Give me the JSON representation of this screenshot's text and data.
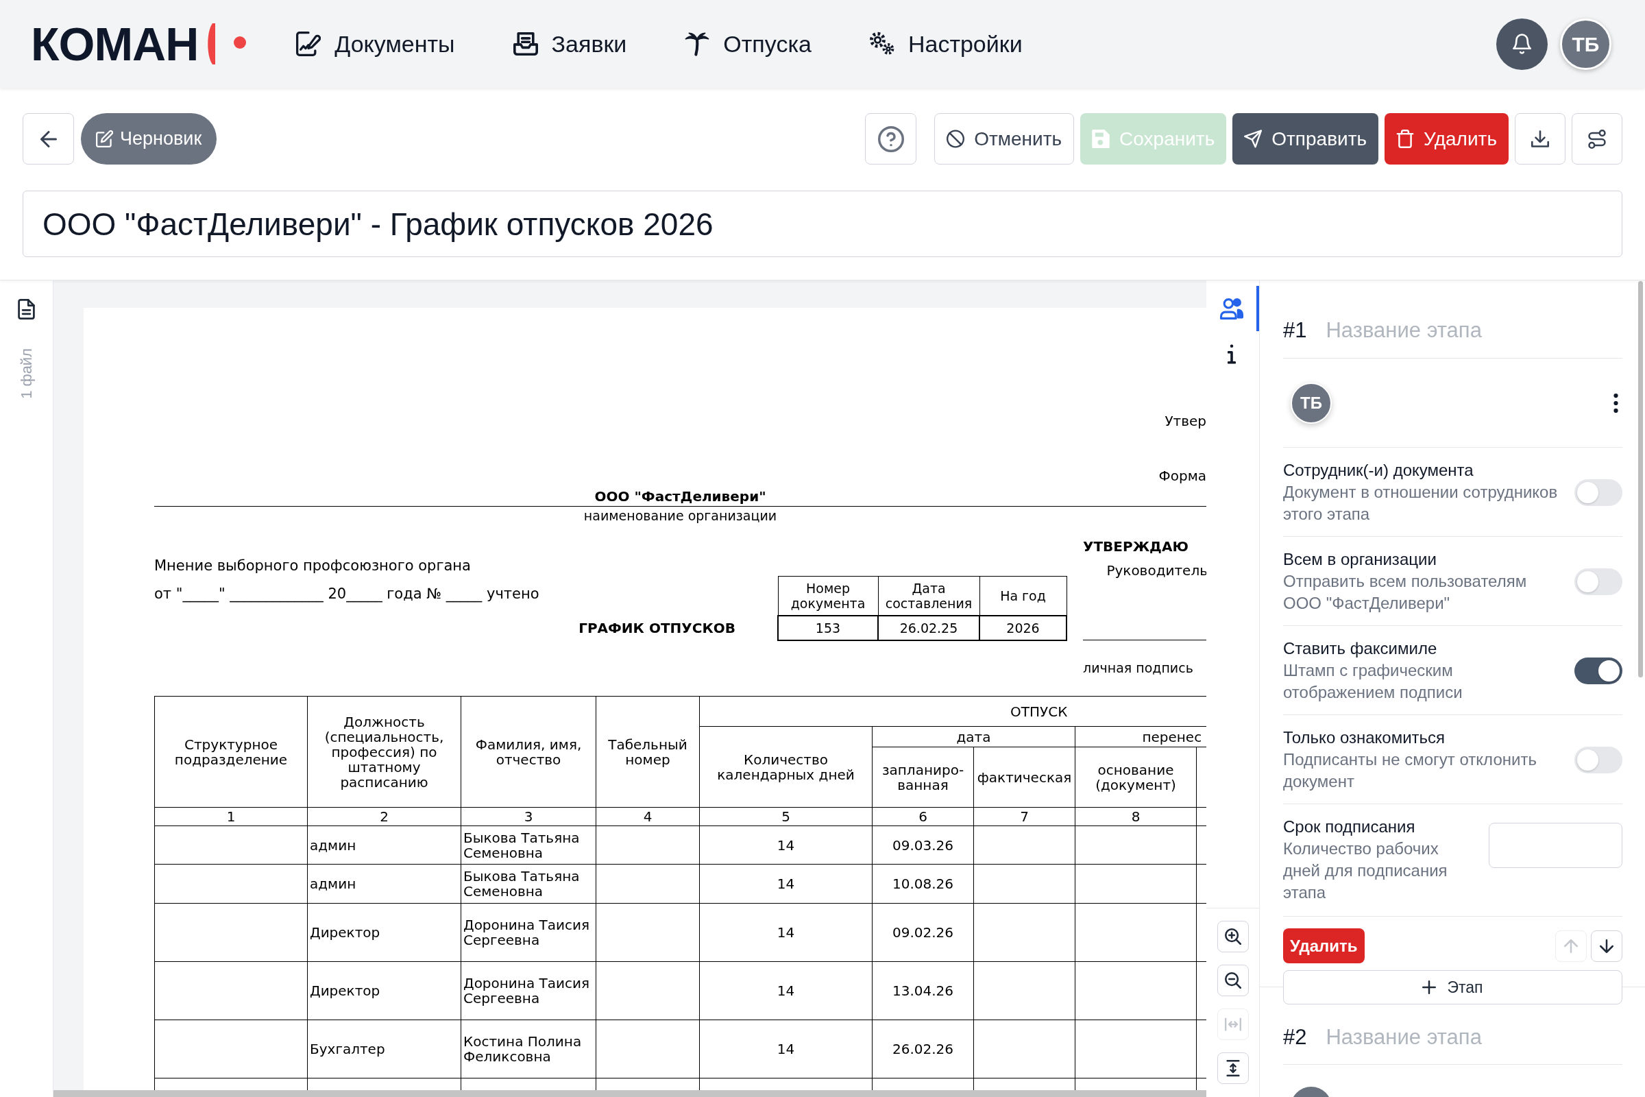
{
  "header": {
    "logo": "КОМАН",
    "nav": [
      {
        "label": "Документы"
      },
      {
        "label": "Заявки"
      },
      {
        "label": "Отпуска"
      },
      {
        "label": "Настройки"
      }
    ],
    "user_initials": "ТБ"
  },
  "toolbar": {
    "status": "Черновик",
    "actions": [
      {
        "label": "Отменить",
        "kind": "cancel",
        "disabled": false
      },
      {
        "label": "Сохранить",
        "kind": "save",
        "disabled": true
      },
      {
        "label": "Отправить",
        "kind": "send",
        "disabled": false
      },
      {
        "label": "Удалить",
        "kind": "delete",
        "disabled": false
      }
    ],
    "title": "ООО \"ФастДеливери\" - График отпусков 2026"
  },
  "files": {
    "count_label": "1 файл"
  },
  "document": {
    "corner_lines": [
      "Утвер",
      "Форма"
    ],
    "organization": "ООО \"ФастДеливери\"",
    "organization_caption": "наименование организации",
    "union_opinion": "Мнение выборного профсоюзного органа",
    "union_record": "от \"_____\" _____________ 20_____ года № _____ учтено",
    "heading": "ГРАФИК ОТПУСКОВ",
    "meta": {
      "columns": [
        "Номер документа",
        "Дата составления",
        "На год"
      ],
      "values": [
        "153",
        "26.02.25",
        "2026"
      ]
    },
    "approval": {
      "heading": "УТВЕРЖДАЮ",
      "role": "Руководитель",
      "signature_caption": "личная подпись"
    },
    "schedule": {
      "group_header": "ОТПУСК",
      "date_header": "дата",
      "transfer_header": "перенес",
      "columns": [
        "Структурное подразделение",
        "Должность (специальность, профессия) по штатному расписанию",
        "Фамилия, имя, отчество",
        "Табельный номер",
        "Количество календарных дней",
        "запланиро-ванная",
        "фактическая",
        "основание (документ)"
      ],
      "column_numbers": [
        "1",
        "2",
        "3",
        "4",
        "5",
        "6",
        "7",
        "8"
      ],
      "rows": [
        {
          "position": "админ",
          "name": "Быкова Татьяна Семеновна",
          "days": "14",
          "planned_date": "09.03.26"
        },
        {
          "position": "админ",
          "name": "Быкова Татьяна Семеновна",
          "days": "14",
          "planned_date": "10.08.26"
        },
        {
          "position": "Директор",
          "name": "Доронина Таисия Сергеевна",
          "days": "14",
          "planned_date": "09.02.26"
        },
        {
          "position": "Директор",
          "name": "Доронина Таисия Сергеевна",
          "days": "14",
          "planned_date": "13.04.26"
        },
        {
          "position": "Бухгалтер",
          "name": "Костина Полина Феликсовна",
          "days": "14",
          "planned_date": "26.02.26"
        }
      ]
    }
  },
  "viewer": {
    "side_tabs": [
      {
        "selected": true
      },
      {
        "selected": false
      }
    ],
    "zoom_tools": [
      {
        "disabled": false
      },
      {
        "disabled": false
      },
      {
        "disabled": true
      },
      {
        "disabled": false
      }
    ]
  },
  "stages": [
    {
      "number": "#1",
      "name_placeholder": "Название этапа",
      "avatars": [
        {
          "kind": "avatar",
          "initials": "ТБ"
        }
      ],
      "options": [
        {
          "title": "Сотрудник(-и) документа",
          "description": "Документ в отношении сотрудников этого этапа",
          "on": false
        },
        {
          "title": "Всем в организации",
          "description": "Отправить всем пользователям ООО \"ФастДеливери\"",
          "on": false
        },
        {
          "title": "Ставить факсимиле",
          "description": "Штамп с графическим отображением подписи",
          "on": true
        },
        {
          "title": "Только ознакомиться",
          "description": "Подписанты не смогут отклонить документ",
          "on": false
        }
      ],
      "deadline": {
        "title": "Срок подписания",
        "description": "Количество рабочих дней для подписания этапа"
      },
      "delete_label": "Удалить",
      "move_buttons": [
        {
          "disabled": true
        },
        {
          "disabled": false
        }
      ],
      "add_stage_label": "Этап"
    },
    {
      "number": "#2",
      "name_placeholder": "Название этапа",
      "avatars": [
        {
          "kind": "avatar"
        }
      ]
    }
  ]
}
